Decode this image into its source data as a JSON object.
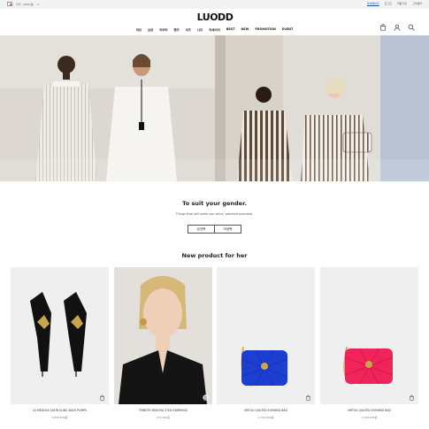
{
  "topbar": {
    "country_label": "한국 · KRW(원)",
    "links": [
      "마이페이지",
      "로그인",
      "회원가입",
      "고객센터"
    ]
  },
  "brand": {
    "logo_text": "LUODD"
  },
  "nav": {
    "items": [
      "여성",
      "남성",
      "아우터",
      "팬츠",
      "셔츠",
      "니트",
      "악세서리",
      "BEST",
      "NEW",
      "PROMOTION",
      "EVENT"
    ]
  },
  "header_icons": [
    "bag-icon",
    "user-icon",
    "search-icon"
  ],
  "gender_section": {
    "title": "To suit your gender.",
    "subtitle": "Things that will make you shine, selected overseas.",
    "buttons": [
      "남성복",
      "여성복"
    ]
  },
  "new_products": {
    "title": "New product for her",
    "items": [
      {
        "name": "LA MEDUSA SATIN SLING BACK PUMPS",
        "price": "1,850,000원"
      },
      {
        "name": "TRIBUTE MEDUSA STUD EARRINGS",
        "price": "470,000원"
      },
      {
        "name": "VIRTUS QUILTED EVENING BAG",
        "price": "1,720,000원"
      },
      {
        "name": "VIRTUS QUILTED EVENING BAG",
        "price": "1,720,000원"
      }
    ]
  },
  "colors": {
    "accent": "#2255aa",
    "bag_blue": "#1d3fd1",
    "bag_pink": "#f0245a"
  }
}
